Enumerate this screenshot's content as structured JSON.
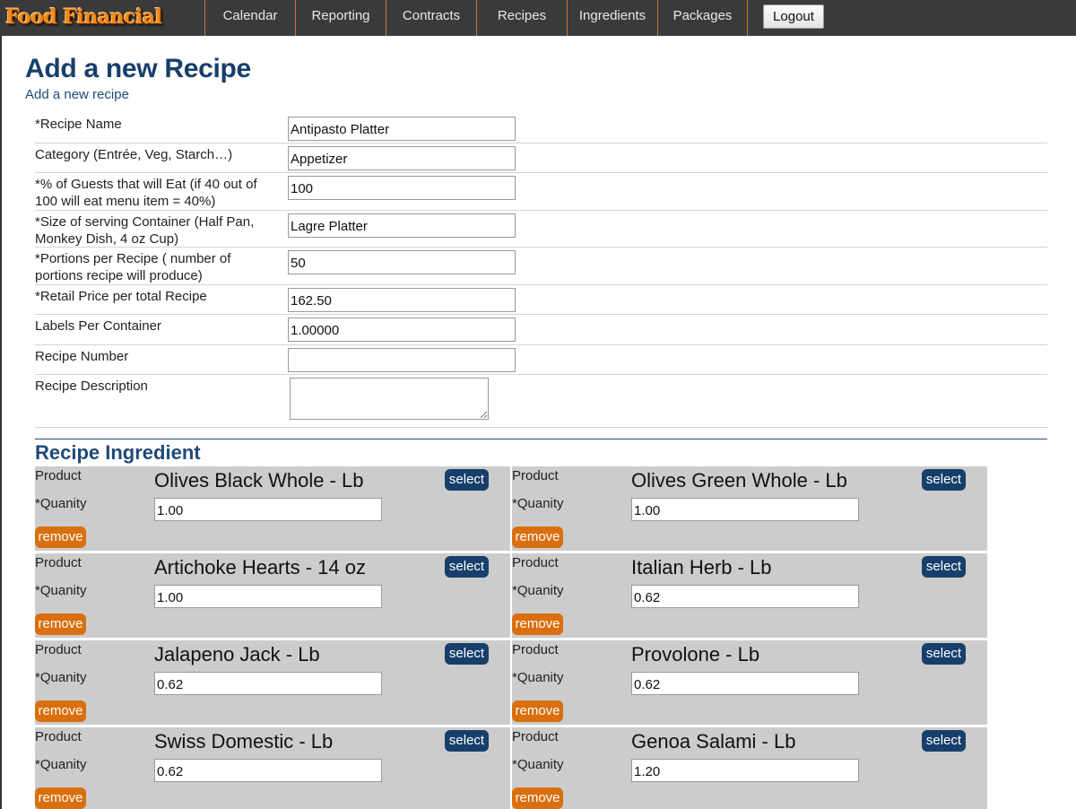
{
  "app": {
    "logo_text": "Food Financial"
  },
  "nav": {
    "items": [
      {
        "label": "Calendar"
      },
      {
        "label": "Reporting"
      },
      {
        "label": "Contracts"
      },
      {
        "label": "Recipes"
      },
      {
        "label": "Ingredients"
      },
      {
        "label": "Packages"
      }
    ],
    "logout_label": "Logout"
  },
  "page": {
    "title": "Add a new Recipe",
    "subtitle": "Add a new recipe"
  },
  "form": {
    "fields": [
      {
        "label": "*Recipe Name",
        "value": "Antipasto Platter"
      },
      {
        "label": "Category (Entrée, Veg, Starch…)",
        "value": "Appetizer"
      },
      {
        "label": "*% of Guests that will Eat (if 40 out of 100 will eat menu item = 40%)",
        "value": "100"
      },
      {
        "label": "*Size of serving Container (Half Pan, Monkey Dish, 4 oz Cup)",
        "value": "Lagre Platter"
      },
      {
        "label": "*Portions per Recipe ( number of portions recipe will produce)",
        "value": "50"
      },
      {
        "label": "*Retail Price per total Recipe",
        "value": "162.50"
      },
      {
        "label": "Labels Per Container",
        "value": "1.00000"
      },
      {
        "label": "Recipe Number",
        "value": ""
      },
      {
        "label": "Recipe Description",
        "value": ""
      }
    ]
  },
  "ingredients_section": {
    "title": "Recipe Ingredient",
    "product_label": "Product",
    "quantity_label": "*Quanity",
    "select_label": "select",
    "remove_label": "remove",
    "items": [
      {
        "name": "Olives Black Whole - Lb",
        "quantity": "1.00"
      },
      {
        "name": "Olives Green Whole - Lb",
        "quantity": "1.00"
      },
      {
        "name": "Artichoke Hearts - 14 oz",
        "quantity": "1.00"
      },
      {
        "name": "Italian Herb - Lb",
        "quantity": "0.62"
      },
      {
        "name": "Jalapeno Jack - Lb",
        "quantity": "0.62"
      },
      {
        "name": "Provolone - Lb",
        "quantity": "0.62"
      },
      {
        "name": "Swiss Domestic - Lb",
        "quantity": "0.62"
      },
      {
        "name": "Genoa Salami - Lb",
        "quantity": "1.20"
      }
    ]
  },
  "colors": {
    "nav_background": "#3a3a3a",
    "heading_blue": "#173f6b",
    "select_button": "#173f6b",
    "remove_button": "#d96f0e",
    "card_background": "#cccccc"
  }
}
